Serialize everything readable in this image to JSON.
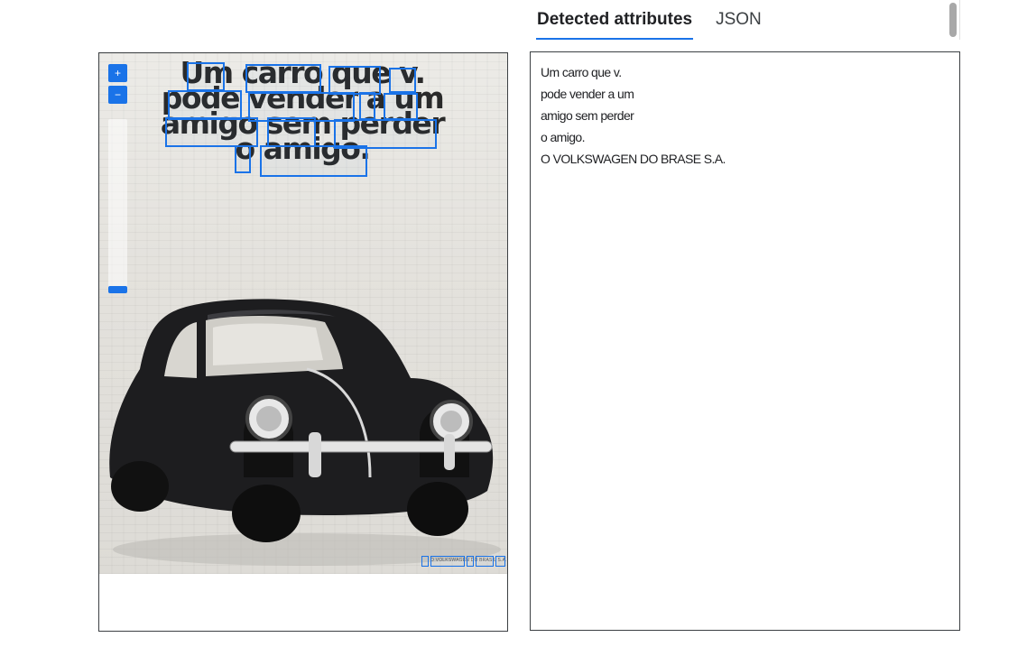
{
  "tabs": [
    {
      "label": "Detected attributes",
      "active": true
    },
    {
      "label": "JSON",
      "active": false
    }
  ],
  "image_panel": {
    "headline_lines": [
      "Um carro que v.",
      "pode vender a um",
      "amigo sem perder",
      "o amigo."
    ],
    "footer_text": "O VOLKSWAGEN DO BRASIL S.A.",
    "zoom_in_icon": "plus-icon",
    "zoom_out_icon": "minus-icon"
  },
  "detected_text": {
    "lines": [
      "Um carro que v.",
      "pode vender a um",
      "amigo sem perder",
      "o amigo.",
      "O VOLKSWAGEN DO BRASE S.A."
    ]
  },
  "colors": {
    "accent": "#1a73e8",
    "text": "#202124",
    "border": "#3c4043"
  }
}
